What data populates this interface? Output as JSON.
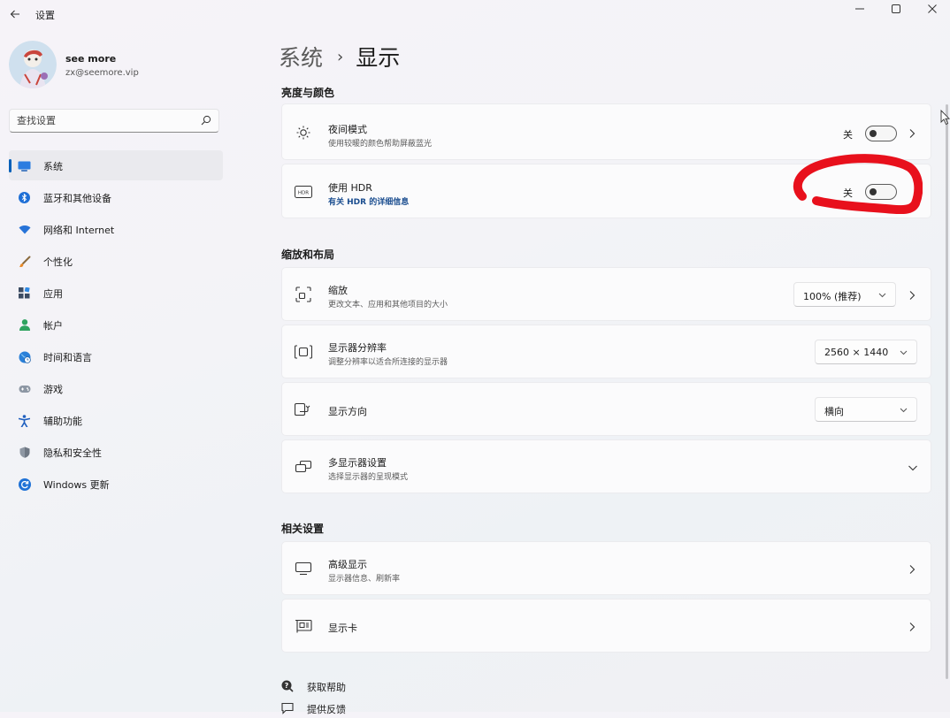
{
  "window": {
    "title": "设置",
    "back_icon": "arrow-left-icon",
    "controls": [
      "minimize-icon",
      "maximize-icon",
      "close-icon"
    ]
  },
  "account": {
    "name": "see more",
    "email": "zx@seemore.vip"
  },
  "search": {
    "placeholder": "查找设置"
  },
  "nav": {
    "items": [
      {
        "label": "系统",
        "icon": "monitor-icon",
        "active": true
      },
      {
        "label": "蓝牙和其他设备",
        "icon": "bluetooth-icon"
      },
      {
        "label": "网络和 Internet",
        "icon": "wifi-icon"
      },
      {
        "label": "个性化",
        "icon": "brush-icon"
      },
      {
        "label": "应用",
        "icon": "apps-icon"
      },
      {
        "label": "帐户",
        "icon": "person-icon"
      },
      {
        "label": "时间和语言",
        "icon": "globe-clock-icon"
      },
      {
        "label": "游戏",
        "icon": "gamepad-icon"
      },
      {
        "label": "辅助功能",
        "icon": "accessibility-icon"
      },
      {
        "label": "隐私和安全性",
        "icon": "shield-icon"
      },
      {
        "label": "Windows 更新",
        "icon": "update-icon"
      }
    ]
  },
  "breadcrumb": {
    "parent": "系统",
    "separator": "›",
    "current": "显示"
  },
  "sections": {
    "brightness": "亮度与颜色",
    "scale_layout": "缩放和布局",
    "related": "相关设置"
  },
  "night_light": {
    "title": "夜间模式",
    "subtitle": "使用较暖的颜色帮助屏蔽蓝光",
    "state": "关",
    "on": false
  },
  "hdr": {
    "title": "使用 HDR",
    "subtitle": "有关 HDR 的详细信息",
    "state": "关",
    "on": false
  },
  "scale": {
    "title": "缩放",
    "subtitle": "更改文本、应用和其他项目的大小",
    "value": "100% (推荐)"
  },
  "resolution": {
    "title": "显示器分辨率",
    "subtitle": "调整分辨率以适合所连接的显示器",
    "value": "2560 × 1440"
  },
  "orientation": {
    "title": "显示方向",
    "value": "横向"
  },
  "multi_display": {
    "title": "多显示器设置",
    "subtitle": "选择显示器的呈现模式"
  },
  "advanced_display": {
    "title": "高级显示",
    "subtitle": "显示器信息、刷新率"
  },
  "graphics": {
    "title": "显示卡"
  },
  "footer": {
    "help": "获取帮助",
    "feedback": "提供反馈"
  },
  "colors": {
    "accent": "#005fb8",
    "annotation": "#e8101c"
  }
}
